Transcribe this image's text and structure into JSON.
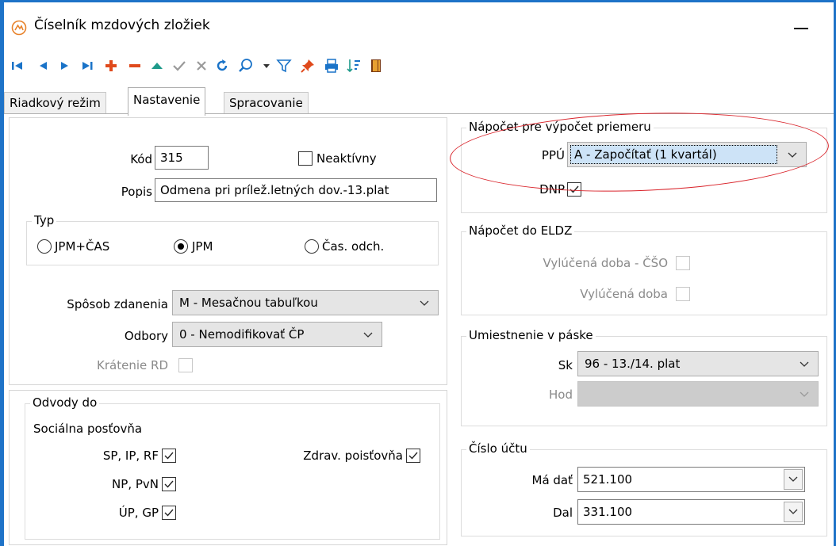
{
  "window": {
    "title": "Číselník mzdových zložiek"
  },
  "toolbar": {
    "icons": [
      "first-icon",
      "prev-icon",
      "next-icon",
      "last-icon",
      "add-icon",
      "delete-icon",
      "up-icon",
      "confirm-icon",
      "cancel-icon",
      "refresh-icon",
      "search-icon",
      "filter-icon",
      "pin-icon",
      "print-icon",
      "sort-icon",
      "exit-icon"
    ]
  },
  "tabs": [
    {
      "label": "Riadkový režim"
    },
    {
      "label": "Nastavenie",
      "active": true
    },
    {
      "label": "Spracovanie"
    }
  ],
  "general": {
    "kod_label": "Kód",
    "kod_value": "315",
    "neaktivny_label": "Neaktívny",
    "neaktivny_checked": false,
    "popis_label": "Popis",
    "popis_value": "Odmena pri prílež.letných dov.-13.plat"
  },
  "typ": {
    "title": "Typ",
    "options": [
      {
        "label": "JPM+ČAS",
        "selected": false
      },
      {
        "label": "JPM",
        "selected": true
      },
      {
        "label": "Čas. odch.",
        "selected": false
      }
    ]
  },
  "zdanenie": {
    "sposob_label": "Spôsob zdanenia",
    "sposob_value": "M - Mesačnou tabuľkou",
    "odbory_label": "Odbory",
    "odbory_value": "0 - Nemodifikovať ČP",
    "kratenie_label": "Krátenie RD",
    "kratenie_checked": false
  },
  "odvody": {
    "title": "Odvody do",
    "socialna_label": "Sociálna posťovňa",
    "sp_label": "SP, IP, RF",
    "sp_checked": true,
    "np_label": "NP, PvN",
    "np_checked": true,
    "up_label": "ÚP, GP",
    "up_checked": true,
    "zdrav_label": "Zdrav. poisťovňa",
    "zdrav_checked": true
  },
  "napocet_priemer": {
    "title": "Nápočet pre výpočet priemeru",
    "ppu_label": "PPÚ",
    "ppu_value": "A - Započítať (1 kvartál)",
    "dnp_label": "DNP",
    "dnp_checked": true
  },
  "napocet_eldz": {
    "title": "Nápočet do ELDZ",
    "cso_label": "Vylúčená doba - ČŠO",
    "cso_checked": false,
    "doba_label": "Vylúčená doba",
    "doba_checked": false
  },
  "umiestnenie": {
    "title": "Umiestnenie v páske",
    "sk_label": "Sk",
    "sk_value": "96 - 13./14. plat",
    "hod_label": "Hod",
    "hod_value": ""
  },
  "cislo_uctu": {
    "title": "Číslo účtu",
    "ma_dat_label": "Má dať",
    "ma_dat_value": "521.100",
    "dal_label": "Dal",
    "dal_value": "331.100"
  },
  "colors": {
    "accent": "#1e73c8",
    "highlight": "#d9232a",
    "app_icon": "#e8822a"
  }
}
